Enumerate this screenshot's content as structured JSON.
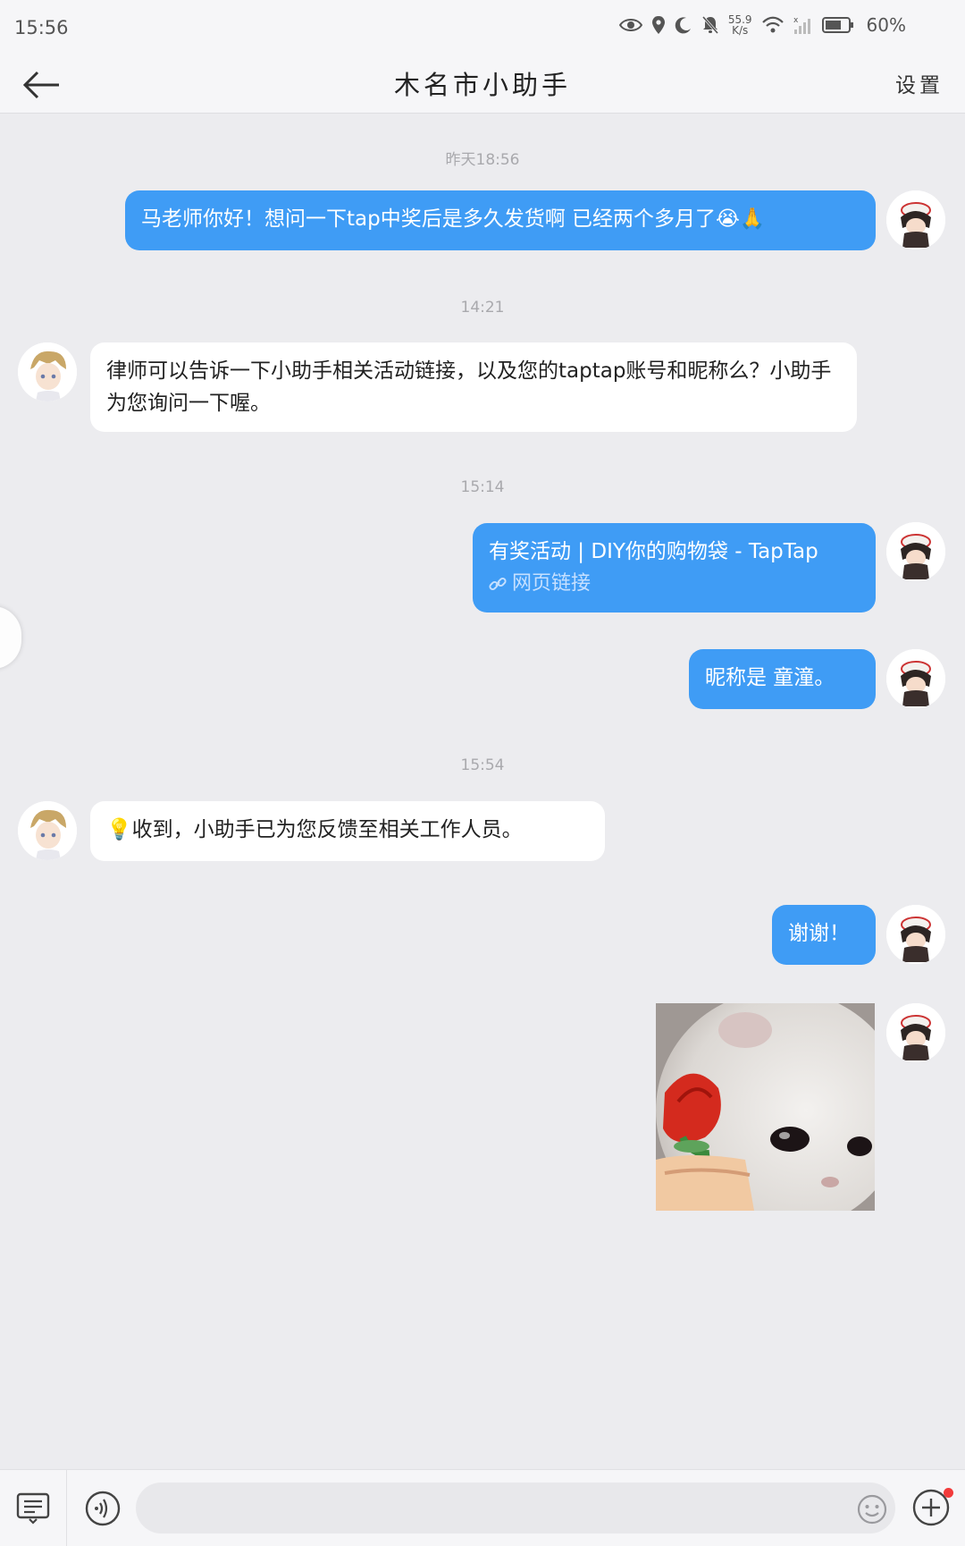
{
  "status_bar": {
    "time": "15:56",
    "net_speed_value": "55.9",
    "net_speed_unit": "K/s",
    "battery": "60%"
  },
  "header": {
    "title": "木名市小助手",
    "settings_label": "设置"
  },
  "timestamps": [
    "昨天18:56",
    "14:21",
    "15:14",
    "15:54"
  ],
  "messages": [
    {
      "from": "me",
      "text": "马老师你好！想问一下tap中奖后是多久发货啊 已经两个多月了😭🙏"
    },
    {
      "from": "assistant",
      "text": "律师可以告诉一下小助手相关活动链接，以及您的taptap账号和昵称么？小助手为您询问一下喔。"
    },
    {
      "from": "me",
      "text": "有奖活动 | DIY你的购物袋 - TapTap",
      "sub": "网页链接"
    },
    {
      "from": "me",
      "text": "昵称是 童潼。"
    },
    {
      "from": "assistant",
      "text": "💡收到，小助手已为您反馈至相关工作人员。"
    },
    {
      "from": "me",
      "text": "谢谢！"
    },
    {
      "from": "me",
      "type": "image",
      "text": ""
    }
  ],
  "input": {
    "placeholder": ""
  },
  "icons": {
    "back": "back-arrow-icon",
    "keyboard": "keyboard-icon",
    "voice": "voice-icon",
    "emoji": "emoji-icon",
    "plus": "plus-icon"
  },
  "colors": {
    "bubble_me": "#3f9cf5",
    "bubble_other": "#ffffff",
    "background": "#ececef",
    "notification_dot": "#f23b3b"
  }
}
